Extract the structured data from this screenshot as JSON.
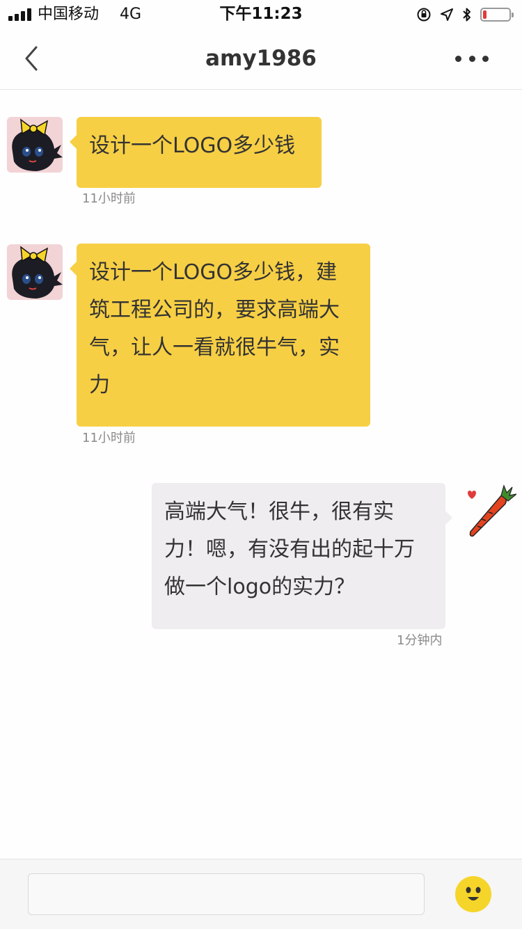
{
  "status_bar": {
    "carrier": "中国移动",
    "network": "4G",
    "time": "下午11:23",
    "battery_level": 0.15,
    "icons": [
      "signal-icon",
      "orientation-lock-icon",
      "location-arrow-icon",
      "bluetooth-icon",
      "battery-icon"
    ]
  },
  "nav": {
    "title": "amy1986",
    "back_icon": "chevron-left-icon",
    "more_icon": "more-dots-icon"
  },
  "messages": [
    {
      "direction": "incoming",
      "avatar": "cartoon-girl-avatar",
      "lines": [
        "设计一个LOGO多少钱"
      ],
      "time": "11小时前"
    },
    {
      "direction": "incoming",
      "avatar": "cartoon-girl-avatar",
      "lines": [
        "设计一个LOGO多少钱，建",
        "筑工程公司的，要求高端大",
        "气，让人一看就很牛气，实",
        "力"
      ],
      "time": "11小时前"
    },
    {
      "direction": "outgoing",
      "avatar": "carrot-avatar",
      "lines": [
        "高端大气！很牛，很有实",
        "力！嗯，有没有出的起十万",
        "做一个logo的实力？"
      ],
      "time": "1分钟内"
    }
  ],
  "input": {
    "value": "",
    "emoji_icon": "smiley-face-icon"
  },
  "colors": {
    "incoming_bubble": "#f7cf44",
    "outgoing_bubble": "#efedef",
    "battery_low": "#e03b3b"
  }
}
